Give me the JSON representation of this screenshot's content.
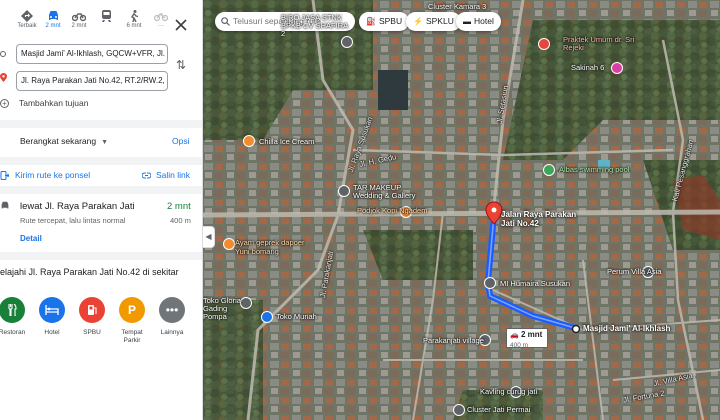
{
  "travel_modes": [
    {
      "name": "best",
      "label": "Terbaik"
    },
    {
      "name": "car",
      "label": "2 mnt"
    },
    {
      "name": "motorcycle",
      "label": "2 mnt"
    },
    {
      "name": "transit",
      "label": ""
    },
    {
      "name": "walk",
      "label": "6 mnt"
    },
    {
      "name": "bicycle",
      "label": "—"
    }
  ],
  "route": {
    "origin": "Masjid Jami' Al-Ikhlash, GQCW+VFR, Jl. Vi",
    "destination": "Jl. Raya Parakan Jati No.42, RT.2/RW.2, Su",
    "add_destination": "Tambahkan tujuan"
  },
  "depart": {
    "label": "Berangkat sekarang",
    "options": "Opsi"
  },
  "actions": {
    "send": "Kirim rute ke ponsel",
    "copy": "Salin link"
  },
  "result": {
    "title": "lewat Jl. Raya Parakan Jati",
    "time": "2 mnt",
    "subtitle": "Rute tercepat, lalu lintas normal",
    "distance": "400 m",
    "detail": "Detail"
  },
  "explore": {
    "title": "elajahi Jl. Raya Parakan Jati No.42 di sekitar",
    "categories": [
      {
        "label": "Restoran",
        "color": "#188038",
        "icon": "fork-knife-icon"
      },
      {
        "label": "Hotel",
        "color": "#1a73e8",
        "icon": "bed-icon"
      },
      {
        "label": "SPBU",
        "color": "#ea4335",
        "icon": "gas-pump-icon"
      },
      {
        "label": "Tempat Parkir",
        "color": "#f29900",
        "icon": "parking-icon"
      },
      {
        "label": "Lainnya",
        "color": "#70757a",
        "icon": "more-icon"
      }
    ]
  },
  "map": {
    "search_placeholder": "Telusuri sepanjang rute",
    "chips": [
      "SPBU",
      "SPKLU",
      "Hotel"
    ],
    "eta": {
      "time": "2 mnt",
      "distance": "400 m"
    },
    "destination_label": "Jalan Raya Parakan Jati No.42",
    "origin_label": "Masjid Jami' Al-Ikhlash",
    "places": [
      "Cluster Kamara 3",
      "BIRO JASA STNK BPKB CV SHAFIRA 2",
      "Praktek Umum dr. Sri Rejeki",
      "Sakinah 6",
      "Chilla Ice Cream",
      "Albas swimming pool",
      "TAR MAKEUP Wedding & Gallery",
      "Podjok Kopi Ngadem",
      "Ayam geprek dapoer Yuni bomang",
      "Perum Villa Asia",
      "MI Humaira Susukan",
      "Toko Gloria Gading Pompa",
      "Toko Munah",
      "Parakanjati village",
      "Kavling curug jati",
      "Cluster Jati Permai"
    ],
    "streets": [
      "Jl. Raya Susukan",
      "Jl. Setasiun",
      "Jl. H. Gedu",
      "Kali Pesanggrahan",
      "Jl. Parakanjati",
      "Jl. Villa Asia",
      "Jl. Fortuna 2"
    ]
  },
  "colors": {
    "accent": "#1a73e8",
    "route": "#1a5cff",
    "time_green": "#188038"
  }
}
